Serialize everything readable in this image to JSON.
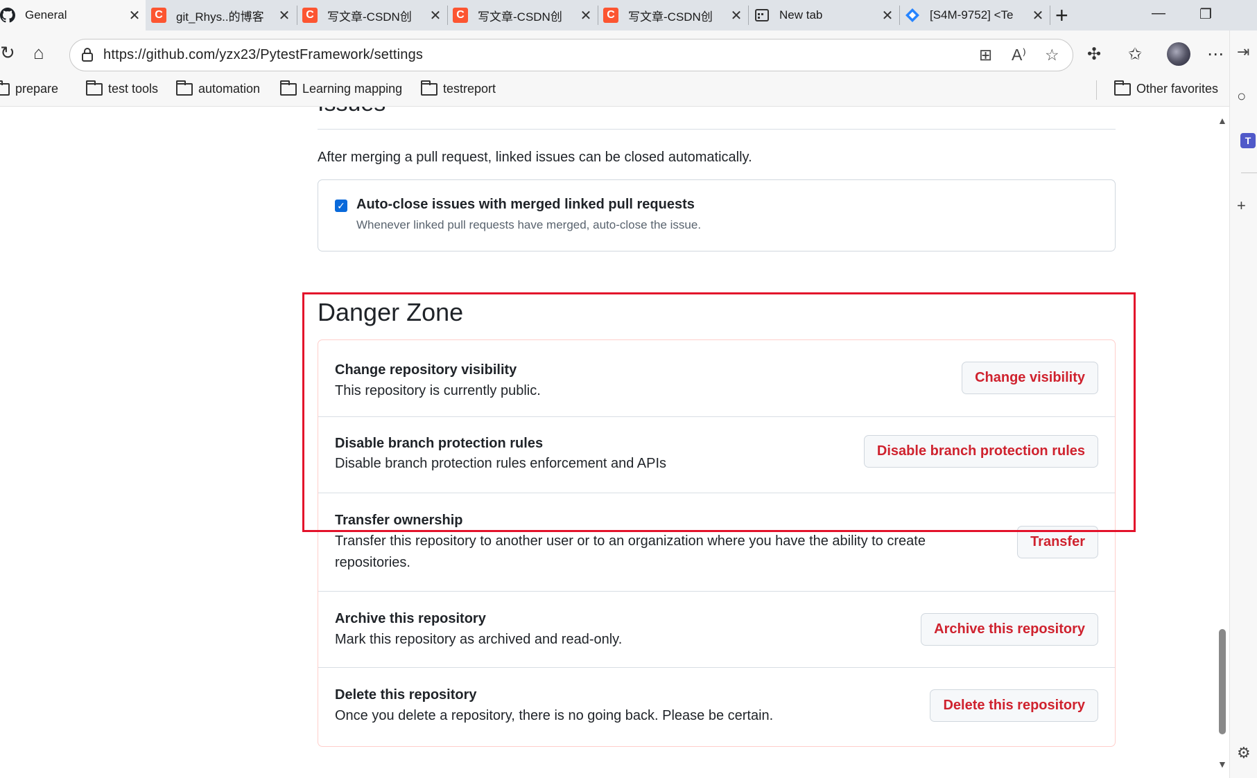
{
  "browser": {
    "tabs": [
      {
        "title": "General",
        "icon": "github-icon",
        "active": true
      },
      {
        "title": "git_Rhys..的博客",
        "icon": "csdn-icon"
      },
      {
        "title": "写文章-CSDN创",
        "icon": "csdn-icon"
      },
      {
        "title": "写文章-CSDN创",
        "icon": "csdn-icon"
      },
      {
        "title": "写文章-CSDN创",
        "icon": "csdn-icon"
      },
      {
        "title": "New tab",
        "icon": "newtab-icon"
      },
      {
        "title": "[S4M-9752] <Te",
        "icon": "jira-icon"
      }
    ],
    "url": "https://github.com/yzx23/PytestFramework/settings",
    "bookmarks": [
      "prepare",
      "test tools",
      "automation",
      "Learning mapping",
      "testreport"
    ],
    "other_favorites": "Other favorites",
    "colors": {
      "csdn": "#fc5531",
      "accent_blue": "#0969da",
      "danger": "#cf222e",
      "highlight": "#e3132b"
    }
  },
  "issues": {
    "heading": "Issues",
    "description": "After merging a pull request, linked issues can be closed automatically.",
    "option_label": "Auto-close issues with merged linked pull requests",
    "option_note": "Whenever linked pull requests have merged, auto-close the issue.",
    "option_checked": true
  },
  "danger_zone": {
    "title": "Danger Zone",
    "rows": [
      {
        "title": "Change repository visibility",
        "desc": "This repository is currently public.",
        "button": "Change visibility"
      },
      {
        "title": "Disable branch protection rules",
        "desc": "Disable branch protection rules enforcement and APIs",
        "button": "Disable branch protection rules"
      },
      {
        "title": "Transfer ownership",
        "desc": "Transfer this repository to another user or to an organization where you have the ability to create repositories.",
        "button": "Transfer"
      },
      {
        "title": "Archive this repository",
        "desc": "Mark this repository as archived and read-only.",
        "button": "Archive this repository"
      },
      {
        "title": "Delete this repository",
        "desc": "Once you delete a repository, there is no going back. Please be certain.",
        "button": "Delete this repository"
      }
    ]
  }
}
